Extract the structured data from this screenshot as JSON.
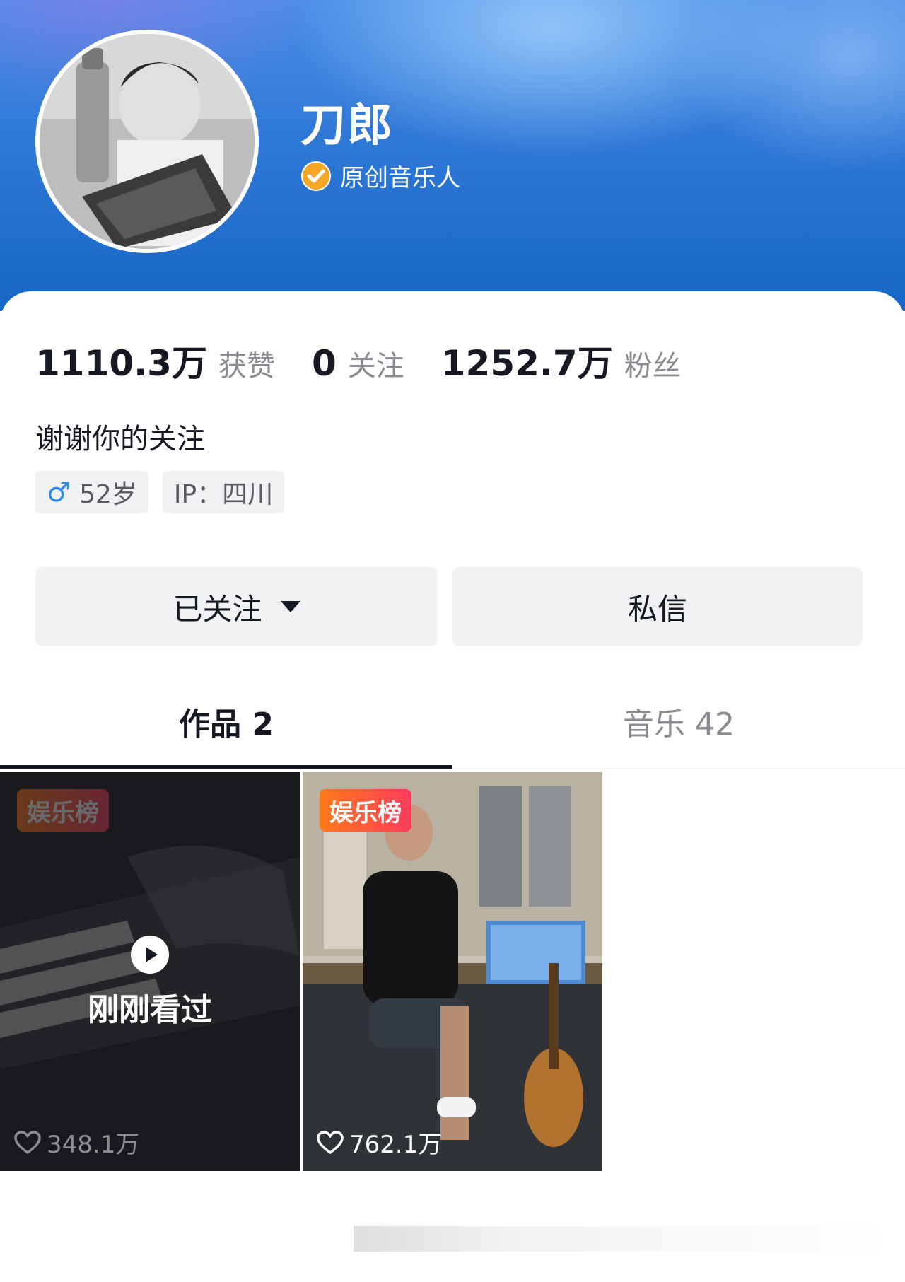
{
  "profile": {
    "nickname": "刀郎",
    "verified_label": "原创音乐人",
    "stats": [
      {
        "value": "1110.3万",
        "label": "获赞"
      },
      {
        "value": "0",
        "label": "关注"
      },
      {
        "value": "1252.7万",
        "label": "粉丝"
      }
    ],
    "bio": "谢谢你的关注",
    "tags": {
      "gender_icon": "male-icon",
      "age": "52岁",
      "ip": "IP：四川"
    }
  },
  "actions": {
    "follow_label": "已关注",
    "message_label": "私信"
  },
  "tabs": [
    {
      "label": "作品 2",
      "active": true
    },
    {
      "label": "音乐 42",
      "active": false
    }
  ],
  "videos": [
    {
      "badge": "娱乐榜",
      "overlay_label": "刚刚看过",
      "likes": "348.1万",
      "watched": true
    },
    {
      "badge": "娱乐榜",
      "overlay_label": "",
      "likes": "762.1万",
      "watched": false
    }
  ],
  "colors": {
    "header_blue": "#1667c7",
    "verify_orange": "#f5a623",
    "badge_gradient_start": "#ff7a1a",
    "badge_gradient_end": "#ff3b5c"
  }
}
